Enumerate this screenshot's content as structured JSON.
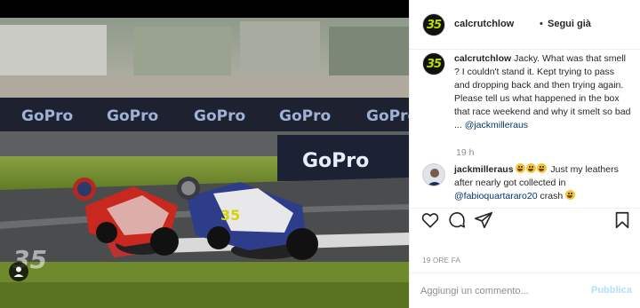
{
  "photo": {
    "watermark": "35",
    "banner_text": "GoPro"
  },
  "header": {
    "username": "calcrutchlow",
    "separator": "•",
    "follow_label": "Segui già",
    "avatar_text": "35"
  },
  "caption": {
    "username": "calcrutchlow",
    "text": "Jacky. What was that smell ? I couldn't stand it. Kept trying to pass and dropping back and then trying again. Please tell us what happened in the box that race weekend and why it smelt so bad ...",
    "mention": "@jackmilleraus",
    "time": "19 h"
  },
  "reply": {
    "username": "jackmilleraus",
    "text": "Just my leathers after nearly got collected in",
    "mention": "@fabioquartararo20",
    "text_after": "crash"
  },
  "actions": {
    "icons": [
      "heart-icon",
      "comment-icon",
      "share-icon",
      "bookmark-icon"
    ]
  },
  "post_date": "19 ORE FA",
  "add_comment": {
    "placeholder": "Aggiungi un commento...",
    "publish_label": "Pubblica"
  },
  "colors": {
    "link": "#00376b",
    "publish_disabled": "#b2dffc",
    "secondary_text": "#8e8e8e",
    "logo_green": "#b5e000"
  }
}
